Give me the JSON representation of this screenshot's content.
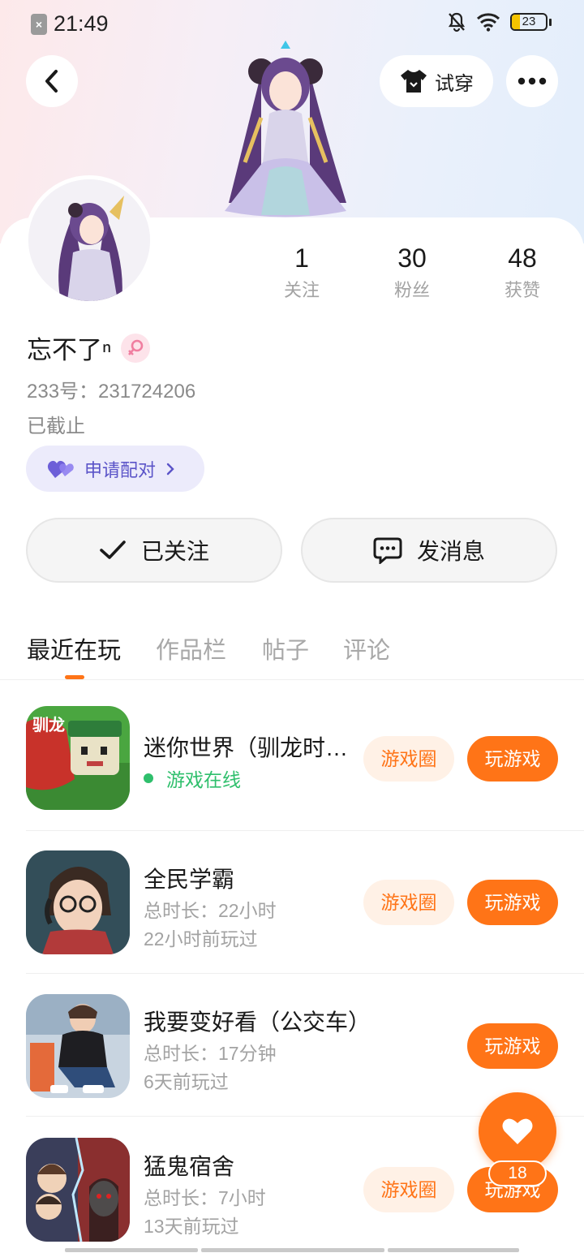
{
  "status_bar": {
    "time": "21:49",
    "battery": "23"
  },
  "header": {
    "tryon_label": "试穿"
  },
  "profile": {
    "stats": [
      {
        "value": "1",
        "label": "关注"
      },
      {
        "value": "30",
        "label": "粉丝"
      },
      {
        "value": "48",
        "label": "获赞"
      }
    ],
    "nickname": "忘不了ⁿ",
    "uid": "233号：231724206",
    "status": "已截止",
    "pair_label": "申请配对",
    "follow_label": "已关注",
    "message_label": "发消息"
  },
  "tabs": [
    {
      "label": "最近在玩",
      "active": true
    },
    {
      "label": "作品栏",
      "active": false
    },
    {
      "label": "帖子",
      "active": false
    },
    {
      "label": "评论",
      "active": false
    }
  ],
  "games": [
    {
      "name": "迷你世界（驯龙时…",
      "online": "游戏在线",
      "circle_label": "游戏圈",
      "play_label": "玩游戏"
    },
    {
      "name": "全民学霸",
      "duration": "总时长：22小时",
      "last_played": "22小时前玩过",
      "circle_label": "游戏圈",
      "play_label": "玩游戏"
    },
    {
      "name": "我要变好看（公交车）",
      "duration": "总时长：17分钟",
      "last_played": "6天前玩过",
      "play_label": "玩游戏"
    },
    {
      "name": "猛鬼宿舍",
      "duration": "总时长：7小时",
      "last_played": "13天前玩过",
      "circle_label": "游戏圈",
      "play_label": "玩游戏"
    }
  ],
  "fab": {
    "count": "18"
  },
  "colors": {
    "accent": "#ff7417",
    "online": "#2fbf6c",
    "pair": "#5b54c8"
  }
}
